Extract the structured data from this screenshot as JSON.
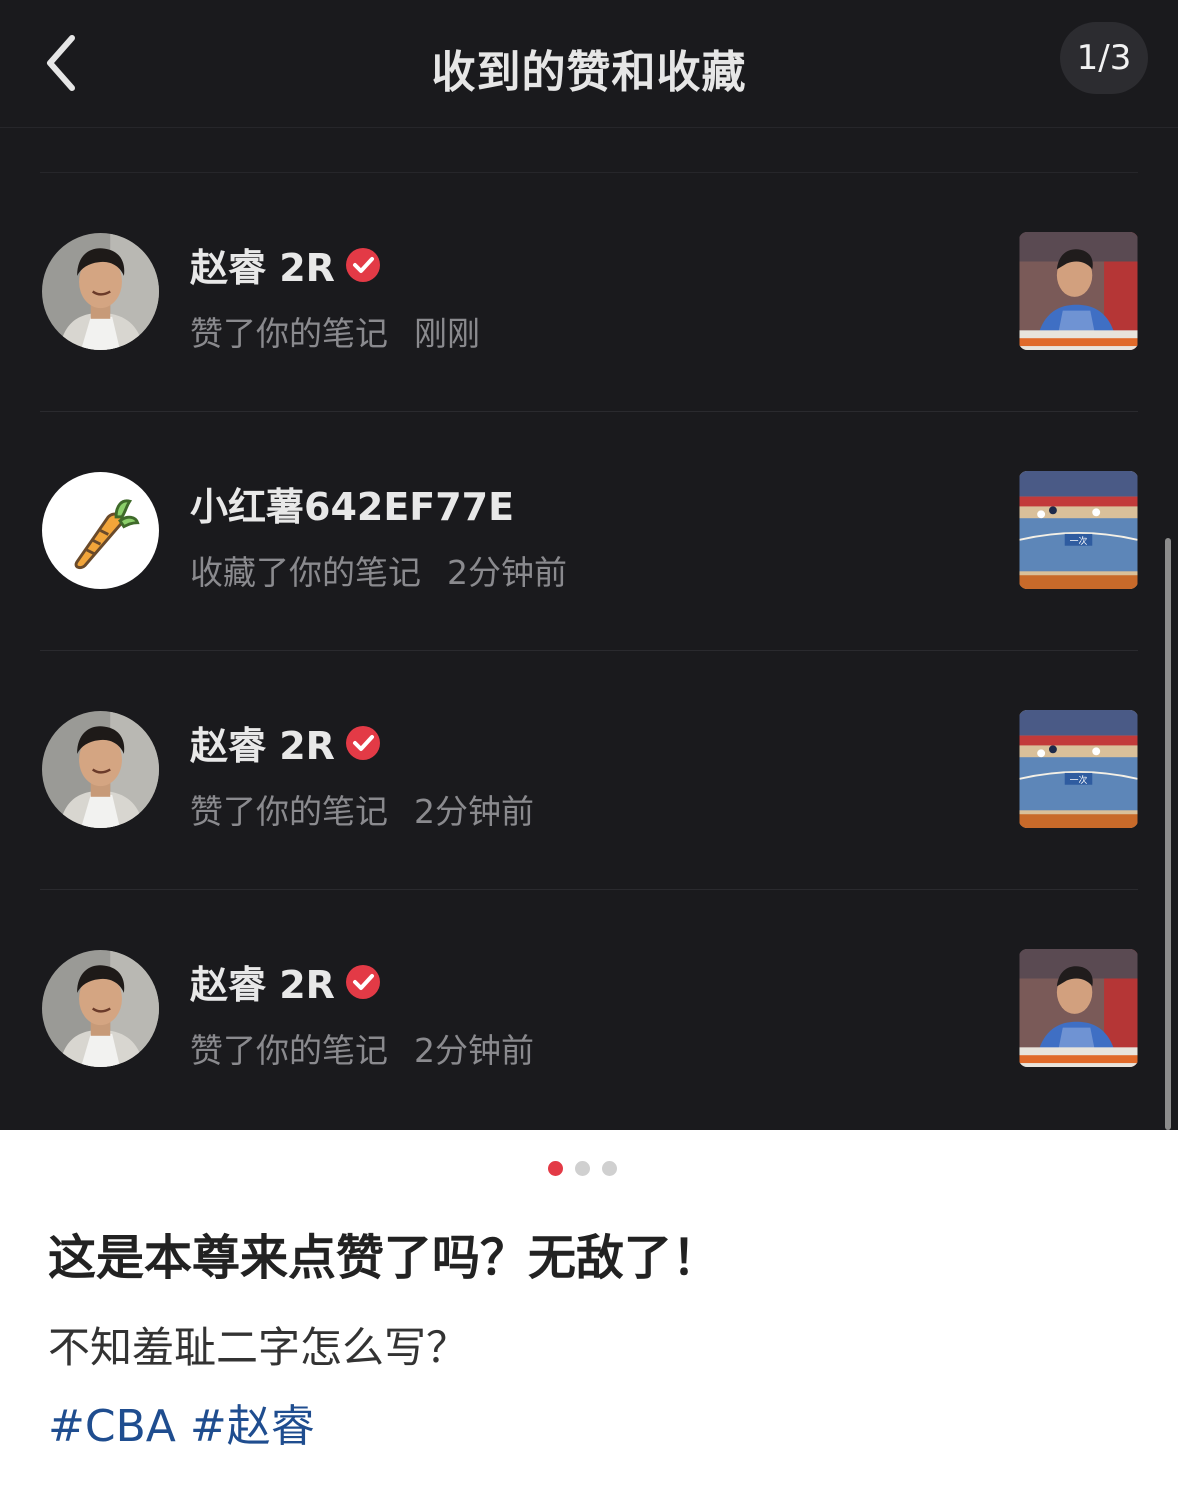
{
  "header": {
    "title": "收到的赞和收藏",
    "page_indicator": "1/3"
  },
  "notifications": [
    {
      "name": "赵睿 2R",
      "verified": true,
      "action": "赞了你的笔记",
      "time": "刚刚",
      "avatar": "player-photo",
      "thumbnail": "player-bench-photo"
    },
    {
      "name": "小红薯642EF77E",
      "verified": false,
      "action": "收藏了你的笔记",
      "time": "2分钟前",
      "avatar": "carrot-icon",
      "thumbnail": "basketball-court-frame"
    },
    {
      "name": "赵睿 2R",
      "verified": true,
      "action": "赞了你的笔记",
      "time": "2分钟前",
      "avatar": "player-photo",
      "thumbnail": "basketball-court-frame"
    },
    {
      "name": "赵睿 2R",
      "verified": true,
      "action": "赞了你的笔记",
      "time": "2分钟前",
      "avatar": "player-photo",
      "thumbnail": "player-bench-photo"
    }
  ],
  "carousel": {
    "total": 3,
    "active": 1
  },
  "post": {
    "title": "这是本尊来点赞了吗？无敌了！",
    "body": "不知羞耻二字怎么写？",
    "tags": [
      "#CBA",
      "#赵睿"
    ]
  },
  "colors": {
    "dark_bg": "#1a1a1d",
    "verified_red": "#e33a46",
    "tag_blue": "#1f4d8f"
  }
}
